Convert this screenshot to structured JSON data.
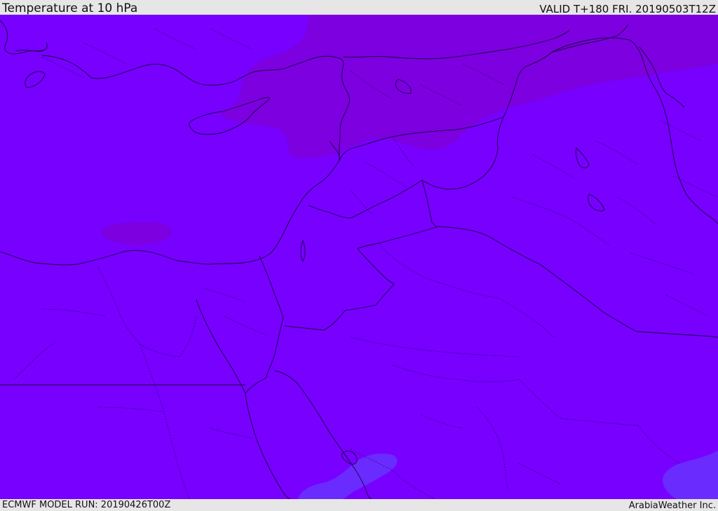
{
  "header": {
    "title": "Temperature at 10 hPa",
    "valid": "VALID T+180 FRI. 20190503T12Z"
  },
  "footer": {
    "model_run": "ECMWF MODEL RUN: 20190426T00Z",
    "credit": "ArabiaWeather Inc."
  },
  "map": {
    "colors": {
      "base_field": "#7700ff",
      "warm_field": "#7c00e0",
      "cool_field": "#6a2bff",
      "borders": "#1a0040"
    }
  }
}
